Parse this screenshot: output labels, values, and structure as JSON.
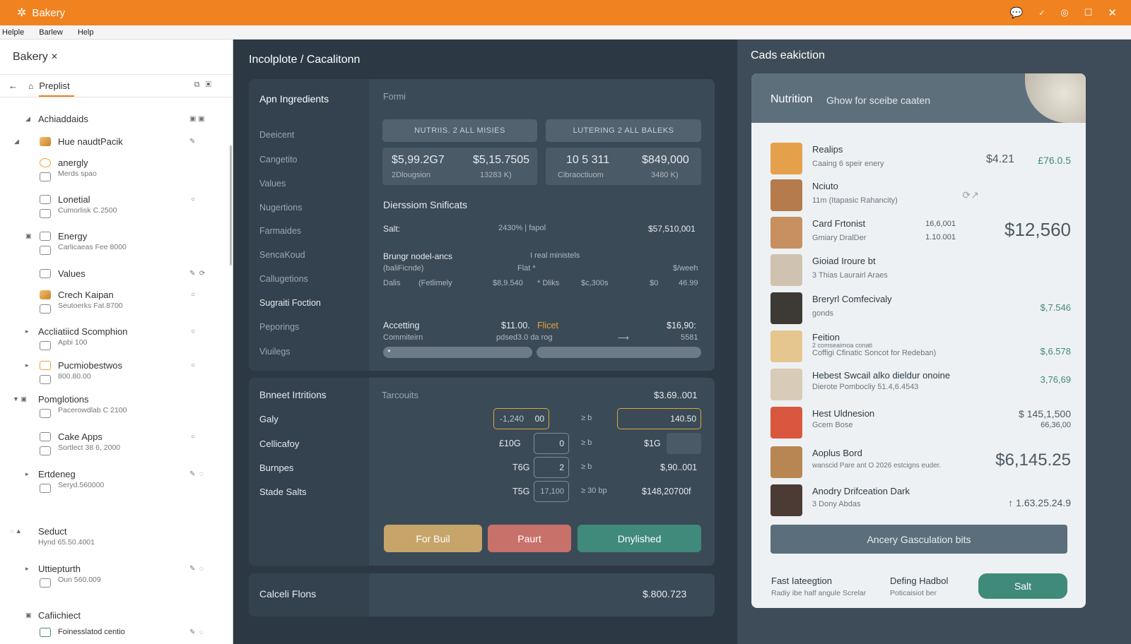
{
  "titlebar": {
    "app": "Bakery",
    "logo": "flower-logo-icon",
    "controls": [
      "chat-icon",
      "minimize-icon",
      "cake-icon",
      "maximize-icon",
      "close-icon"
    ]
  },
  "menu": [
    "Helple",
    "Barlew",
    "Help"
  ],
  "sidebar": {
    "title": "Bakery ×",
    "tab": "Preplist",
    "rows": [
      {
        "label": "Achiaddaids",
        "kind": "header"
      },
      {
        "label": "Hue naudtPacik"
      },
      {
        "label": "anergly",
        "sub": "Merds spao"
      },
      {
        "label": "Lonetial",
        "sub": "Cumorlisk C.2500"
      },
      {
        "label": "Energy",
        "sub": "Carlicaeas Fee 8000"
      },
      {
        "label": "Values"
      },
      {
        "label": "Crech Kaipan",
        "sub": "Seutoerks Fat.8700"
      },
      {
        "label": "Accliatiicd Scomphion",
        "sub": "Apbi 100"
      },
      {
        "label": "Pucmiobestwos",
        "sub": "800.80.00"
      },
      {
        "label": "Pomglotions",
        "sub": "Pacerowdlab C 2100"
      },
      {
        "label": "Cake Apps",
        "sub": "Sortlect 38 6, 2000"
      },
      {
        "label": "Ertdeneg",
        "sub": "Seryd.560000"
      },
      {
        "label": "Seduct",
        "sub": "Hynd 65.50.4001"
      },
      {
        "label": "Uttiepturth",
        "sub": "Oun 560.009"
      },
      {
        "label": "Cafiichiect"
      },
      {
        "label": "Foinesslatod centio"
      }
    ]
  },
  "center": {
    "title": "Incolplote / Cacalitonn",
    "panel1": {
      "heading": "Apn Ingredients",
      "side": [
        "Deeicent",
        "Cangetito",
        "Values",
        "Nugertions",
        "Farmaides",
        "SencaKoud",
        "Callugetions",
        "Sugraiti Foction",
        "Peporings",
        "Viuilegs"
      ],
      "form": "Formi",
      "pill1": "NUTRIIS. 2 ALL MISIES",
      "pill2": "LUTERING 2 ALL BALEKS",
      "stat1a": "$5,99.2G7",
      "stat1b": "$5,15.7505",
      "stat1c": "2Dlougsion",
      "stat1d": "13283 K)",
      "stat2a": "10 5 311",
      "stat2b": "$849,000",
      "stat2c": "Cibraoctiuom",
      "stat2d": "3480 K)",
      "section": "Dierssiom Snificats",
      "salt": "Salt:",
      "saltmid": "2430% | fapol",
      "saltval": "$57,510,001",
      "bl1": "Brungr nodel-ancs",
      "bl1r": "I real ministels",
      "bl2": "(baliFicnde)",
      "bl2m": "Flat *",
      "bl2r": "$/weeh",
      "bl3": "Dalis",
      "bl3b": "(Fetlimely",
      "bl3c": "$8,9.540",
      "bl3d": "* Dliks",
      "bl3e": "$c,300s",
      "bl3f": "$0",
      "bl3g": "46.99",
      "acc": "Accetting",
      "accv": "$11.00.",
      "accf": "Flicet",
      "accr": "$16,90:",
      "acc2": "Commiteirn",
      "acc2m": "pdsed3.0  da rog",
      "acc2r": "5581",
      "progress": [
        0.02,
        0.0
      ]
    },
    "panel2": {
      "heading": "Bnneet Irtritions",
      "side": [
        "Galy",
        "Cellicafoy",
        "Burnpes",
        "Stade Salts"
      ],
      "tr": "Tarcouits",
      "trv": "$3.69..001",
      "g1": "-1,240",
      "g1b": "00",
      "g1c": "≥ b",
      "g1d": "140.50",
      "c1": "£10G",
      "c1b": "0",
      "c1c": "≥ b",
      "c1d": "$1G",
      "b1": "T6G",
      "b1b": "2",
      "b1c": "≥ b",
      "b1d": "$,90..001",
      "s1": "T5G",
      "s1b": "17,100",
      "s1c": "≥ 30  bp",
      "s1d": "$148,20700f",
      "btn1": "For Buil",
      "btn2": "Paurt",
      "btn3": "Dnylished"
    },
    "panel3": {
      "label": "Calceli Flons",
      "value": "$.800.723"
    }
  },
  "right": {
    "header": "Cads eakiction",
    "card_t1": "Nutrition",
    "card_t2": "Ghow for sceibe caaten",
    "items": [
      {
        "name": "Realips",
        "desc": "Caaing 6 speir enery",
        "price": "$4.21",
        "price2": "£76.0.5",
        "thumb": "#e5a04c"
      },
      {
        "name": "Nciuto",
        "desc": "11m (Itapasic Rahancity)",
        "price": "",
        "price2": "",
        "thumb": "#b57b4c"
      },
      {
        "name": "Card Frtonist",
        "desc": "Gmiary DralDer",
        "mid": "16,6,001",
        "mid2": "1.10.001",
        "price": "$12,560",
        "thumb": "#c89060"
      },
      {
        "name": "Gioiad Iroure bt",
        "desc": "3 Thias Laurairl Araes",
        "price": "",
        "thumb": "#d0c2b0"
      },
      {
        "name": "Breryrl Comfecivaly",
        "desc": "gonds",
        "price": "$,7.546",
        "thumb": "#3d3a35"
      },
      {
        "name": "Feition",
        "desc": "2 comseaimoa conati",
        "desc2": "Coffigi Cfinatic Soncot for Redeban)",
        "price": "$,6.578",
        "thumb": "#e6c68f"
      },
      {
        "name": "Hebest Swcail alko dieldur onoine",
        "desc": "Dierote Pombocliy 51.4,6.4543",
        "price": "3,76,69",
        "thumb": "#d8cbb8"
      },
      {
        "name": "Hest Uldnesion",
        "desc": "Gcem Bose",
        "price": "$ 145,1,500",
        "price2": "66,36,00",
        "thumb": "#d9573f"
      },
      {
        "name": "Aoplus Bord",
        "desc": "wanscid Pare ant O 2026 estcigns euder.",
        "price": "$6,145.25",
        "thumb": "#b88652"
      },
      {
        "name": "Anodry Drifceation Dark",
        "desc": "3 Dony Abdas",
        "price": "↑ 1.63.25.24.9",
        "thumb": "#4b3b34"
      }
    ],
    "big_button": "Ancery Gasculation bits",
    "foot1": "Fast Iateegtion",
    "foot1s": "Radiy ibe half angule Screlar",
    "foot2": "Defing Hadbol",
    "foot2s": "Poticaisiot ber",
    "salt_button": "Salt"
  }
}
